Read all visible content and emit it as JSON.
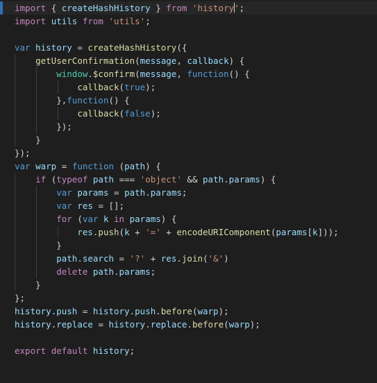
{
  "editor": {
    "language": "javascript",
    "theme": "dark-plus",
    "cursor_line": 1,
    "tab_size": 4,
    "colors": {
      "background": "#1e1e1e",
      "current_line_background": "#262626",
      "current_line_marker": "#2f6fba",
      "foreground": "#d4d4d4",
      "keyword": "#c586c0",
      "control": "#569cd6",
      "function": "#dcdcaa",
      "variable": "#9cdcfe",
      "string": "#ce9178",
      "class": "#4ec9b0",
      "indent_guide": "#3f3f3f",
      "caret": "#d4d4d4"
    }
  },
  "lines": [
    {
      "n": 1,
      "current": true,
      "indent": 0,
      "guides": [],
      "tokens": [
        {
          "t": "import",
          "c": "t-key"
        },
        {
          "t": " ",
          "c": "t-punc"
        },
        {
          "t": "{",
          "c": "t-punc"
        },
        {
          "t": " ",
          "c": "t-punc"
        },
        {
          "t": "createHashHistory",
          "c": "t-var"
        },
        {
          "t": " ",
          "c": "t-punc"
        },
        {
          "t": "}",
          "c": "t-punc"
        },
        {
          "t": " ",
          "c": "t-punc"
        },
        {
          "t": "from",
          "c": "t-key"
        },
        {
          "t": " ",
          "c": "t-punc"
        },
        {
          "t": "'history",
          "c": "t-str"
        },
        {
          "t": "",
          "c": "caret"
        },
        {
          "t": "'",
          "c": "t-str"
        },
        {
          "t": ";",
          "c": "t-punc"
        }
      ]
    },
    {
      "n": 2,
      "current": false,
      "indent": 0,
      "guides": [],
      "tokens": [
        {
          "t": "import",
          "c": "t-key"
        },
        {
          "t": " ",
          "c": "t-punc"
        },
        {
          "t": "utils",
          "c": "t-var"
        },
        {
          "t": " ",
          "c": "t-punc"
        },
        {
          "t": "from",
          "c": "t-key"
        },
        {
          "t": " ",
          "c": "t-punc"
        },
        {
          "t": "'utils'",
          "c": "t-str"
        },
        {
          "t": ";",
          "c": "t-punc"
        }
      ]
    },
    {
      "n": 3,
      "current": false,
      "indent": 0,
      "guides": [],
      "tokens": []
    },
    {
      "n": 4,
      "current": false,
      "indent": 0,
      "guides": [],
      "tokens": [
        {
          "t": "var",
          "c": "t-ctrl"
        },
        {
          "t": " ",
          "c": "t-punc"
        },
        {
          "t": "history",
          "c": "t-var"
        },
        {
          "t": " ",
          "c": "t-punc"
        },
        {
          "t": "=",
          "c": "t-op"
        },
        {
          "t": " ",
          "c": "t-punc"
        },
        {
          "t": "createHashHistory",
          "c": "t-fn"
        },
        {
          "t": "({",
          "c": "t-punc"
        }
      ]
    },
    {
      "n": 5,
      "current": false,
      "indent": 4,
      "guides": [
        1
      ],
      "tokens": [
        {
          "t": "    ",
          "c": "t-punc"
        },
        {
          "t": "getUserConfirmation",
          "c": "t-fn"
        },
        {
          "t": "(",
          "c": "t-punc"
        },
        {
          "t": "message",
          "c": "t-var"
        },
        {
          "t": ", ",
          "c": "t-punc"
        },
        {
          "t": "callback",
          "c": "t-var"
        },
        {
          "t": ") {",
          "c": "t-punc"
        }
      ]
    },
    {
      "n": 6,
      "current": false,
      "indent": 8,
      "guides": [
        1,
        2
      ],
      "tokens": [
        {
          "t": "        ",
          "c": "t-punc"
        },
        {
          "t": "window",
          "c": "t-cls"
        },
        {
          "t": ".",
          "c": "t-punc"
        },
        {
          "t": "$confirm",
          "c": "t-fn"
        },
        {
          "t": "(",
          "c": "t-punc"
        },
        {
          "t": "message",
          "c": "t-var"
        },
        {
          "t": ", ",
          "c": "t-punc"
        },
        {
          "t": "function",
          "c": "t-ctrl"
        },
        {
          "t": "() {",
          "c": "t-punc"
        }
      ]
    },
    {
      "n": 7,
      "current": false,
      "indent": 12,
      "guides": [
        1,
        2,
        3
      ],
      "tokens": [
        {
          "t": "            ",
          "c": "t-punc"
        },
        {
          "t": "callback",
          "c": "t-fn"
        },
        {
          "t": "(",
          "c": "t-punc"
        },
        {
          "t": "true",
          "c": "t-ctrl"
        },
        {
          "t": ");",
          "c": "t-punc"
        }
      ]
    },
    {
      "n": 8,
      "current": false,
      "indent": 8,
      "guides": [
        1,
        2
      ],
      "tokens": [
        {
          "t": "        ",
          "c": "t-punc"
        },
        {
          "t": "},",
          "c": "t-punc"
        },
        {
          "t": "function",
          "c": "t-ctrl"
        },
        {
          "t": "() {",
          "c": "t-punc"
        }
      ]
    },
    {
      "n": 9,
      "current": false,
      "indent": 12,
      "guides": [
        1,
        2,
        3
      ],
      "tokens": [
        {
          "t": "            ",
          "c": "t-punc"
        },
        {
          "t": "callback",
          "c": "t-fn"
        },
        {
          "t": "(",
          "c": "t-punc"
        },
        {
          "t": "false",
          "c": "t-ctrl"
        },
        {
          "t": ");",
          "c": "t-punc"
        }
      ]
    },
    {
      "n": 10,
      "current": false,
      "indent": 8,
      "guides": [
        1,
        2
      ],
      "tokens": [
        {
          "t": "        ",
          "c": "t-punc"
        },
        {
          "t": "});",
          "c": "t-punc"
        }
      ]
    },
    {
      "n": 11,
      "current": false,
      "indent": 4,
      "guides": [
        1
      ],
      "tokens": [
        {
          "t": "    ",
          "c": "t-punc"
        },
        {
          "t": "}",
          "c": "t-punc"
        }
      ]
    },
    {
      "n": 12,
      "current": false,
      "indent": 0,
      "guides": [],
      "tokens": [
        {
          "t": "});",
          "c": "t-punc"
        }
      ]
    },
    {
      "n": 13,
      "current": false,
      "indent": 0,
      "guides": [],
      "tokens": [
        {
          "t": "var",
          "c": "t-ctrl"
        },
        {
          "t": " ",
          "c": "t-punc"
        },
        {
          "t": "warp",
          "c": "t-var"
        },
        {
          "t": " ",
          "c": "t-punc"
        },
        {
          "t": "=",
          "c": "t-op"
        },
        {
          "t": " ",
          "c": "t-punc"
        },
        {
          "t": "function",
          "c": "t-ctrl"
        },
        {
          "t": " (",
          "c": "t-punc"
        },
        {
          "t": "path",
          "c": "t-var"
        },
        {
          "t": ") {",
          "c": "t-punc"
        }
      ]
    },
    {
      "n": 14,
      "current": false,
      "indent": 4,
      "guides": [
        1
      ],
      "tokens": [
        {
          "t": "    ",
          "c": "t-punc"
        },
        {
          "t": "if",
          "c": "t-key"
        },
        {
          "t": " (",
          "c": "t-punc"
        },
        {
          "t": "typeof",
          "c": "t-key"
        },
        {
          "t": " ",
          "c": "t-punc"
        },
        {
          "t": "path",
          "c": "t-var"
        },
        {
          "t": " ",
          "c": "t-punc"
        },
        {
          "t": "===",
          "c": "t-op"
        },
        {
          "t": " ",
          "c": "t-punc"
        },
        {
          "t": "'object'",
          "c": "t-str"
        },
        {
          "t": " ",
          "c": "t-punc"
        },
        {
          "t": "&&",
          "c": "t-op"
        },
        {
          "t": " ",
          "c": "t-punc"
        },
        {
          "t": "path",
          "c": "t-var"
        },
        {
          "t": ".",
          "c": "t-punc"
        },
        {
          "t": "params",
          "c": "t-var"
        },
        {
          "t": ") {",
          "c": "t-punc"
        }
      ]
    },
    {
      "n": 15,
      "current": false,
      "indent": 8,
      "guides": [
        1,
        2
      ],
      "tokens": [
        {
          "t": "        ",
          "c": "t-punc"
        },
        {
          "t": "var",
          "c": "t-ctrl"
        },
        {
          "t": " ",
          "c": "t-punc"
        },
        {
          "t": "params",
          "c": "t-var"
        },
        {
          "t": " ",
          "c": "t-punc"
        },
        {
          "t": "=",
          "c": "t-op"
        },
        {
          "t": " ",
          "c": "t-punc"
        },
        {
          "t": "path",
          "c": "t-var"
        },
        {
          "t": ".",
          "c": "t-punc"
        },
        {
          "t": "params",
          "c": "t-var"
        },
        {
          "t": ";",
          "c": "t-punc"
        }
      ]
    },
    {
      "n": 16,
      "current": false,
      "indent": 8,
      "guides": [
        1,
        2
      ],
      "tokens": [
        {
          "t": "        ",
          "c": "t-punc"
        },
        {
          "t": "var",
          "c": "t-ctrl"
        },
        {
          "t": " ",
          "c": "t-punc"
        },
        {
          "t": "res",
          "c": "t-var"
        },
        {
          "t": " ",
          "c": "t-punc"
        },
        {
          "t": "=",
          "c": "t-op"
        },
        {
          "t": " ",
          "c": "t-punc"
        },
        {
          "t": "[];",
          "c": "t-punc"
        }
      ]
    },
    {
      "n": 17,
      "current": false,
      "indent": 8,
      "guides": [
        1,
        2
      ],
      "tokens": [
        {
          "t": "        ",
          "c": "t-punc"
        },
        {
          "t": "for",
          "c": "t-key"
        },
        {
          "t": " (",
          "c": "t-punc"
        },
        {
          "t": "var",
          "c": "t-ctrl"
        },
        {
          "t": " ",
          "c": "t-punc"
        },
        {
          "t": "k",
          "c": "t-var"
        },
        {
          "t": " ",
          "c": "t-punc"
        },
        {
          "t": "in",
          "c": "t-key"
        },
        {
          "t": " ",
          "c": "t-punc"
        },
        {
          "t": "params",
          "c": "t-var"
        },
        {
          "t": ") {",
          "c": "t-punc"
        }
      ]
    },
    {
      "n": 18,
      "current": false,
      "indent": 12,
      "guides": [
        1,
        2,
        3
      ],
      "tokens": [
        {
          "t": "            ",
          "c": "t-punc"
        },
        {
          "t": "res",
          "c": "t-var"
        },
        {
          "t": ".",
          "c": "t-punc"
        },
        {
          "t": "push",
          "c": "t-fn"
        },
        {
          "t": "(",
          "c": "t-punc"
        },
        {
          "t": "k",
          "c": "t-var"
        },
        {
          "t": " ",
          "c": "t-punc"
        },
        {
          "t": "+",
          "c": "t-op"
        },
        {
          "t": " ",
          "c": "t-punc"
        },
        {
          "t": "'='",
          "c": "t-str"
        },
        {
          "t": " ",
          "c": "t-punc"
        },
        {
          "t": "+",
          "c": "t-op"
        },
        {
          "t": " ",
          "c": "t-punc"
        },
        {
          "t": "encodeURIComponent",
          "c": "t-fn"
        },
        {
          "t": "(",
          "c": "t-punc"
        },
        {
          "t": "params",
          "c": "t-var"
        },
        {
          "t": "[",
          "c": "t-punc"
        },
        {
          "t": "k",
          "c": "t-var"
        },
        {
          "t": "]));",
          "c": "t-punc"
        }
      ]
    },
    {
      "n": 19,
      "current": false,
      "indent": 8,
      "guides": [
        1,
        2
      ],
      "tokens": [
        {
          "t": "        ",
          "c": "t-punc"
        },
        {
          "t": "}",
          "c": "t-punc"
        }
      ]
    },
    {
      "n": 20,
      "current": false,
      "indent": 8,
      "guides": [
        1,
        2
      ],
      "tokens": [
        {
          "t": "        ",
          "c": "t-punc"
        },
        {
          "t": "path",
          "c": "t-var"
        },
        {
          "t": ".",
          "c": "t-punc"
        },
        {
          "t": "search",
          "c": "t-var"
        },
        {
          "t": " ",
          "c": "t-punc"
        },
        {
          "t": "=",
          "c": "t-op"
        },
        {
          "t": " ",
          "c": "t-punc"
        },
        {
          "t": "'?'",
          "c": "t-str"
        },
        {
          "t": " ",
          "c": "t-punc"
        },
        {
          "t": "+",
          "c": "t-op"
        },
        {
          "t": " ",
          "c": "t-punc"
        },
        {
          "t": "res",
          "c": "t-var"
        },
        {
          "t": ".",
          "c": "t-punc"
        },
        {
          "t": "join",
          "c": "t-fn"
        },
        {
          "t": "(",
          "c": "t-punc"
        },
        {
          "t": "'&'",
          "c": "t-str"
        },
        {
          "t": ")",
          "c": "t-punc"
        }
      ]
    },
    {
      "n": 21,
      "current": false,
      "indent": 8,
      "guides": [
        1,
        2
      ],
      "tokens": [
        {
          "t": "        ",
          "c": "t-punc"
        },
        {
          "t": "delete",
          "c": "t-key"
        },
        {
          "t": " ",
          "c": "t-punc"
        },
        {
          "t": "path",
          "c": "t-var"
        },
        {
          "t": ".",
          "c": "t-punc"
        },
        {
          "t": "params",
          "c": "t-var"
        },
        {
          "t": ";",
          "c": "t-punc"
        }
      ]
    },
    {
      "n": 22,
      "current": false,
      "indent": 4,
      "guides": [
        1
      ],
      "tokens": [
        {
          "t": "    ",
          "c": "t-punc"
        },
        {
          "t": "}",
          "c": "t-punc"
        }
      ]
    },
    {
      "n": 23,
      "current": false,
      "indent": 0,
      "guides": [],
      "tokens": [
        {
          "t": "};",
          "c": "t-punc"
        }
      ]
    },
    {
      "n": 24,
      "current": false,
      "indent": 0,
      "guides": [],
      "tokens": [
        {
          "t": "history",
          "c": "t-var"
        },
        {
          "t": ".",
          "c": "t-punc"
        },
        {
          "t": "push",
          "c": "t-var"
        },
        {
          "t": " ",
          "c": "t-punc"
        },
        {
          "t": "=",
          "c": "t-op"
        },
        {
          "t": " ",
          "c": "t-punc"
        },
        {
          "t": "history",
          "c": "t-var"
        },
        {
          "t": ".",
          "c": "t-punc"
        },
        {
          "t": "push",
          "c": "t-var"
        },
        {
          "t": ".",
          "c": "t-punc"
        },
        {
          "t": "before",
          "c": "t-fn"
        },
        {
          "t": "(",
          "c": "t-punc"
        },
        {
          "t": "warp",
          "c": "t-var"
        },
        {
          "t": ");",
          "c": "t-punc"
        }
      ]
    },
    {
      "n": 25,
      "current": false,
      "indent": 0,
      "guides": [],
      "tokens": [
        {
          "t": "history",
          "c": "t-var"
        },
        {
          "t": ".",
          "c": "t-punc"
        },
        {
          "t": "replace",
          "c": "t-var"
        },
        {
          "t": " ",
          "c": "t-punc"
        },
        {
          "t": "=",
          "c": "t-op"
        },
        {
          "t": " ",
          "c": "t-punc"
        },
        {
          "t": "history",
          "c": "t-var"
        },
        {
          "t": ".",
          "c": "t-punc"
        },
        {
          "t": "replace",
          "c": "t-var"
        },
        {
          "t": ".",
          "c": "t-punc"
        },
        {
          "t": "before",
          "c": "t-fn"
        },
        {
          "t": "(",
          "c": "t-punc"
        },
        {
          "t": "warp",
          "c": "t-var"
        },
        {
          "t": ");",
          "c": "t-punc"
        }
      ]
    },
    {
      "n": 26,
      "current": false,
      "indent": 0,
      "guides": [],
      "tokens": []
    },
    {
      "n": 27,
      "current": false,
      "indent": 0,
      "guides": [],
      "tokens": [
        {
          "t": "export",
          "c": "t-key"
        },
        {
          "t": " ",
          "c": "t-punc"
        },
        {
          "t": "default",
          "c": "t-key"
        },
        {
          "t": " ",
          "c": "t-punc"
        },
        {
          "t": "history",
          "c": "t-var"
        },
        {
          "t": ";",
          "c": "t-punc"
        }
      ]
    }
  ]
}
